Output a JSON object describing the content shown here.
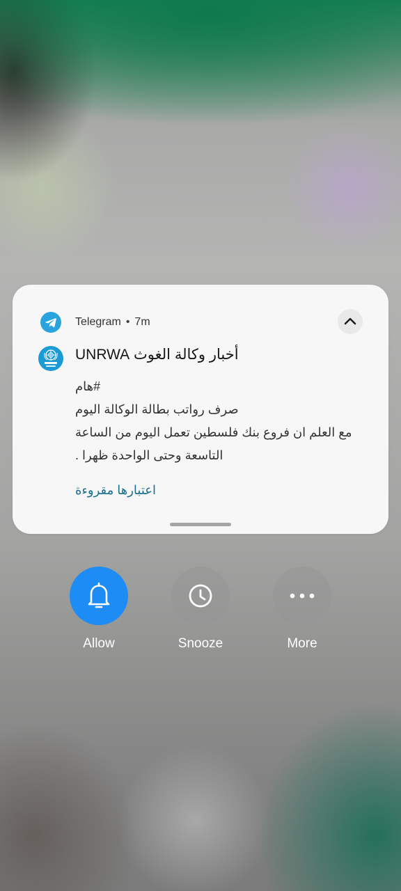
{
  "notification": {
    "app_name": "Telegram",
    "separator": "•",
    "time": "7m",
    "app_icon": "telegram-icon",
    "avatar_icon": "unrwa-logo-icon",
    "collapse_icon": "chevron-up-icon",
    "title": "أخبار وكالة الغوث UNRWA",
    "body_lines": [
      "#هام",
      "صرف رواتب بطالة الوكالة اليوم",
      "مع العلم ان فروع بنك فلسطين تعمل اليوم من الساعة",
      "التاسعة وحتى الواحدة ظهرا ."
    ],
    "action_label": "اعتبارها مقروءة"
  },
  "quick_actions": [
    {
      "label": "Allow",
      "icon": "bell-icon",
      "color": "#1d8cf5"
    },
    {
      "label": "Snooze",
      "icon": "clock-icon"
    },
    {
      "label": "More",
      "icon": "more-dots-icon"
    }
  ],
  "colors": {
    "accent": "#1d8cf5",
    "telegram": "#2aa3de",
    "link": "#1a6e8e"
  }
}
